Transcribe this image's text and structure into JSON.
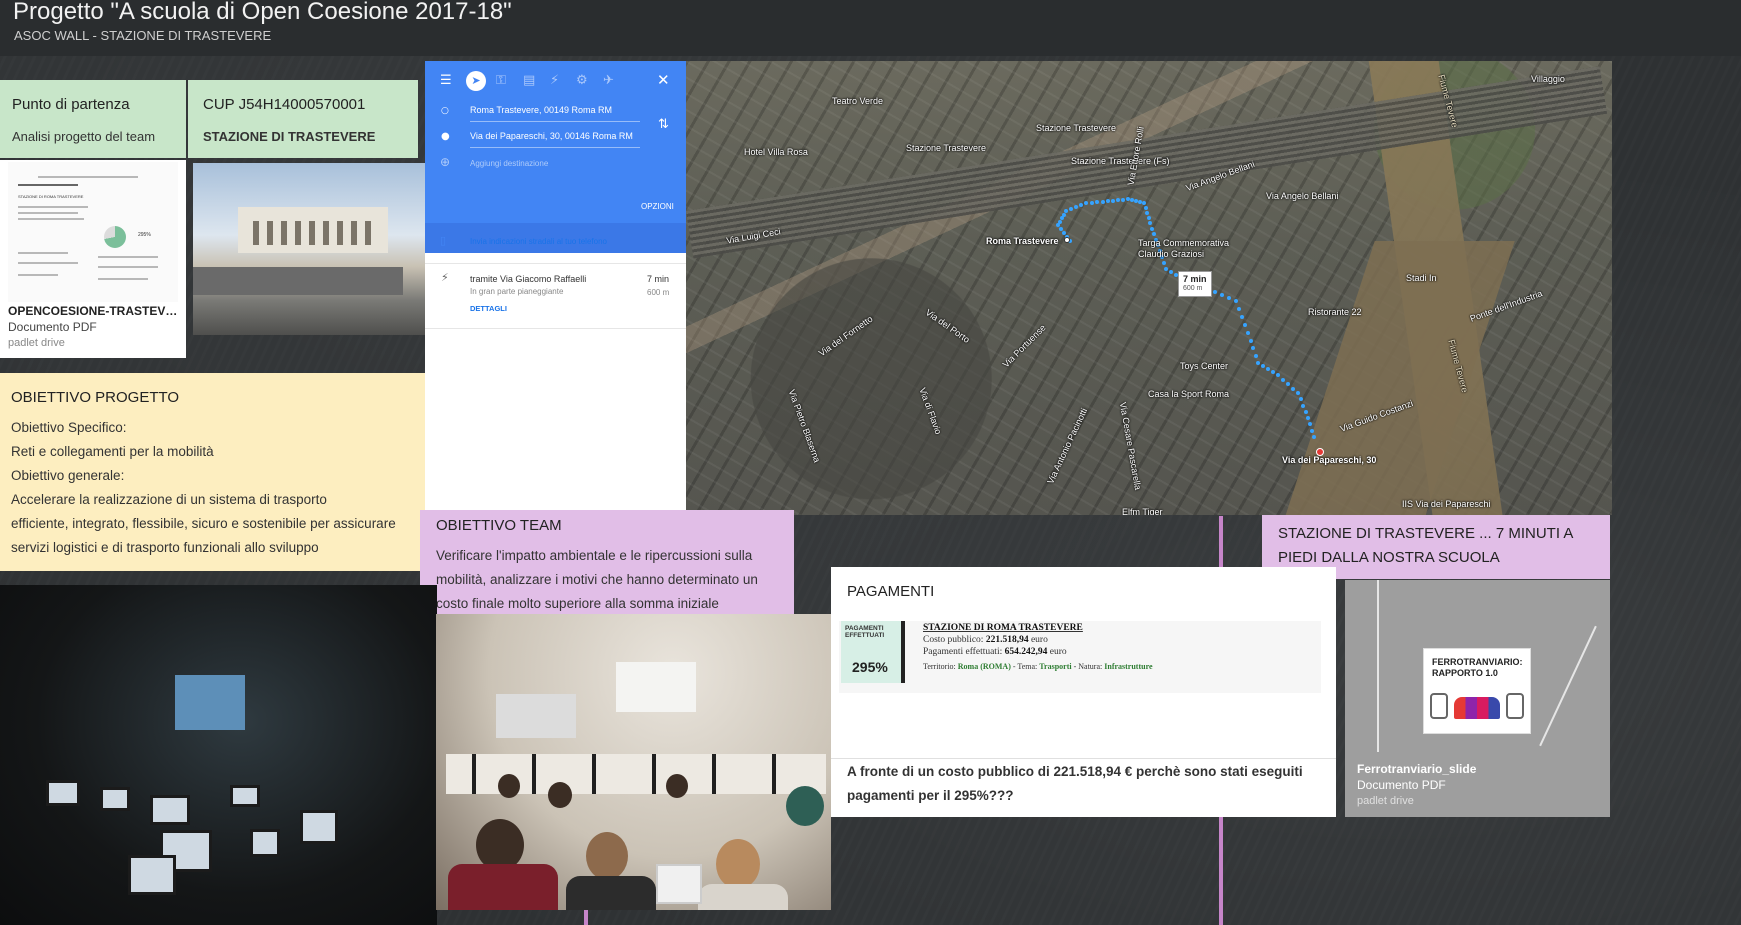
{
  "header": {
    "title": "Progetto \"A scuola di Open Coesione 2017-18\"",
    "subtitle": "ASOC WALL - STAZIONE DI TRASTEVERE"
  },
  "cards": {
    "start": {
      "title": "Punto di partenza",
      "body": "Analisi progetto del team"
    },
    "cup": {
      "title": "CUP J54H14000570001",
      "body": "STAZIONE DI TRASTEVERE"
    },
    "pdf1": {
      "name": "OPENCOESIONE-TRASTEVE...",
      "type": "Documento PDF",
      "source": "padlet drive",
      "thumb_title": "STAZIONE DI ROMA TRASTEVERE",
      "thumb_pct": "295%"
    },
    "objective": {
      "title": "OBIETTIVO PROGETTO",
      "lines": [
        "Obiettivo Specifico:",
        "Reti e collegamenti per la mobilità",
        "Obiettivo generale:",
        "Accelerare la realizzazione di un sistema di trasporto",
        "efficiente, integrato, flessibile, sicuro e sostenibile per assicurare",
        "servizi logistici e di trasporto funzionali allo sviluppo"
      ]
    },
    "team": {
      "title": "OBIETTIVO TEAM",
      "lines": [
        "Verificare l'impatto ambientale e le ripercussioni sulla",
        "mobilità, analizzare i motivi che hanno determinato un",
        "costo finale molto superiore alla somma iniziale"
      ]
    },
    "station_walk": {
      "title_lines": [
        "STAZIONE DI TRASTEVERE ... 7 MINUTI A",
        "PIEDI DALLA NOSTRA SCUOLA"
      ]
    },
    "payments": {
      "title": "PAGAMENTI",
      "badge_label": "PAGAMENTI EFFETTUATI",
      "badge_pct": "295%",
      "station": "STAZIONE DI ROMA TRASTEVERE",
      "cost_label": "Costo pubblico:",
      "cost_value": "221.518,94",
      "cost_unit": "euro",
      "paid_label": "Pagamenti effettuati:",
      "paid_value": "654.242,94",
      "paid_unit": "euro",
      "meta_territorio_label": "Territorio:",
      "meta_territorio": "Roma (ROMA)",
      "meta_tema_label": "Tema:",
      "meta_tema": "Trasporti",
      "meta_natura_label": "Natura:",
      "meta_natura": "Infrastrutture",
      "question_lines": [
        "A fronte di un costo pubblico di 221.518,94 € perchè sono stati eseguiti",
        "pagamenti per il 295%???"
      ]
    },
    "rail_pdf": {
      "slide_title_lines": [
        "FERROTRANVIARIO:",
        "RAPPORTO 1.0"
      ],
      "name": "Ferrotranviario_slide",
      "type": "Documento PDF",
      "source": "padlet drive"
    }
  },
  "maps": {
    "origin": "Roma Trastevere, 00149 Roma RM",
    "destination": "Via dei Papareschi, 30, 00146 Roma RM",
    "add_destination": "Aggiungi destinazione",
    "options": "OPZIONI",
    "send_to_phone": "Invia indicazioni stradali al tuo telefono",
    "route_via": "tramite Via Giacomo Raffaelli",
    "route_note": "In gran parte pianeggiante",
    "route_time": "7 min",
    "route_dist": "600 m",
    "details": "DETTAGLI",
    "icons": [
      "menu-icon",
      "directions-icon",
      "car-icon",
      "transit-icon",
      "walk-icon",
      "bike-icon",
      "flight-icon",
      "close-icon"
    ]
  },
  "map": {
    "labels": {
      "teatro_verde": "Teatro Verde",
      "villaggio": "Villaggio",
      "hotel_villa_rosa": "Hotel Villa Rosa",
      "stazione_trastevere_1": "Stazione Trastevere",
      "stazione_trastevere_2": "Stazione Trastevere",
      "stazione_trastevere_fs": "Stazione Trastevere (Fs)",
      "via_ettore_rolli": "Via Ettore Rolli",
      "via_angelo_bellani_1": "Via Angelo Bellani",
      "via_angelo_bellani_2": "Via Angelo Bellani",
      "fiume_tevere_1": "Fiume Tevere",
      "fiume_tevere_2": "Fiume Tevere",
      "via_luigi_ceci": "Via Luigi Ceci",
      "roma_trastevere": "Roma Trastevere",
      "targa": "Targa Commemorativa",
      "targa2": "Claudio Graziosi",
      "stadio": "Stadi In",
      "ristorante": "Ristorante 22",
      "ponte_industria": "Ponte dell'Industria",
      "via_del_fornetto": "Via del Fornetto",
      "via_portuense": "Via Portuense",
      "via_del_porto": "Via del Porto",
      "toys_center": "Toys Center",
      "casa_sport": "Casa la Sport Roma",
      "via_papareschi": "Via dei Papareschi, 30",
      "via_pacinotti": "Via Antonio Pacinotti",
      "via_papareschi2": "Via dei Papareschi",
      "via_blaserna": "Via Pietro Blaserna",
      "via_flavio": "Via di Flavio",
      "via_cosentino": "Via Cesare Pascarella",
      "via_costanzi": "Via Guido Costanzi",
      "elfm": "Elfm Tiger",
      "iis": "IIS Via dei Papareschi"
    },
    "route_time": "7 min",
    "route_dist": "600 m"
  }
}
